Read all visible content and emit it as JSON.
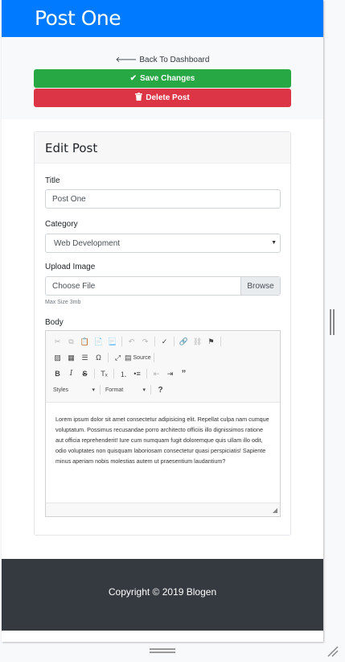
{
  "header": {
    "title": "Post One"
  },
  "actions": {
    "back_label": "Back To Dashboard",
    "save_label": "Save Changes",
    "delete_label": "Delete Post"
  },
  "form": {
    "card_title": "Edit Post",
    "title_label": "Title",
    "title_value": "Post One",
    "category_label": "Category",
    "category_value": "Web Development",
    "upload_label": "Upload Image",
    "file_placeholder": "Choose File",
    "browse_label": "Browse",
    "max_size": "Max Size 3mb",
    "body_label": "Body"
  },
  "editor": {
    "source_label": "Source",
    "styles_label": "Styles",
    "format_label": "Format",
    "help_label": "?",
    "content": "Lorem ipsum dolor sit amet consectetur adipisicing elit. Repellat culpa nam cumque voluptatum. Possimus recusandae porro architecto officiis illo dignissimos ratione aut officia reprehenderit! Iure cum numquam fugit doloremque quis ullam illo odit, odio voluptates non quisquam laboriosam consectetur quasi perspiciatis! Sapiente minus aperiam nobis molestias autem ut praesentium laudantium?"
  },
  "footer": {
    "copyright": "Copyright © 2019 Blogen"
  },
  "colors": {
    "header": "#007bff",
    "save": "#28a745",
    "delete": "#dc3545",
    "footer": "#343a40"
  }
}
